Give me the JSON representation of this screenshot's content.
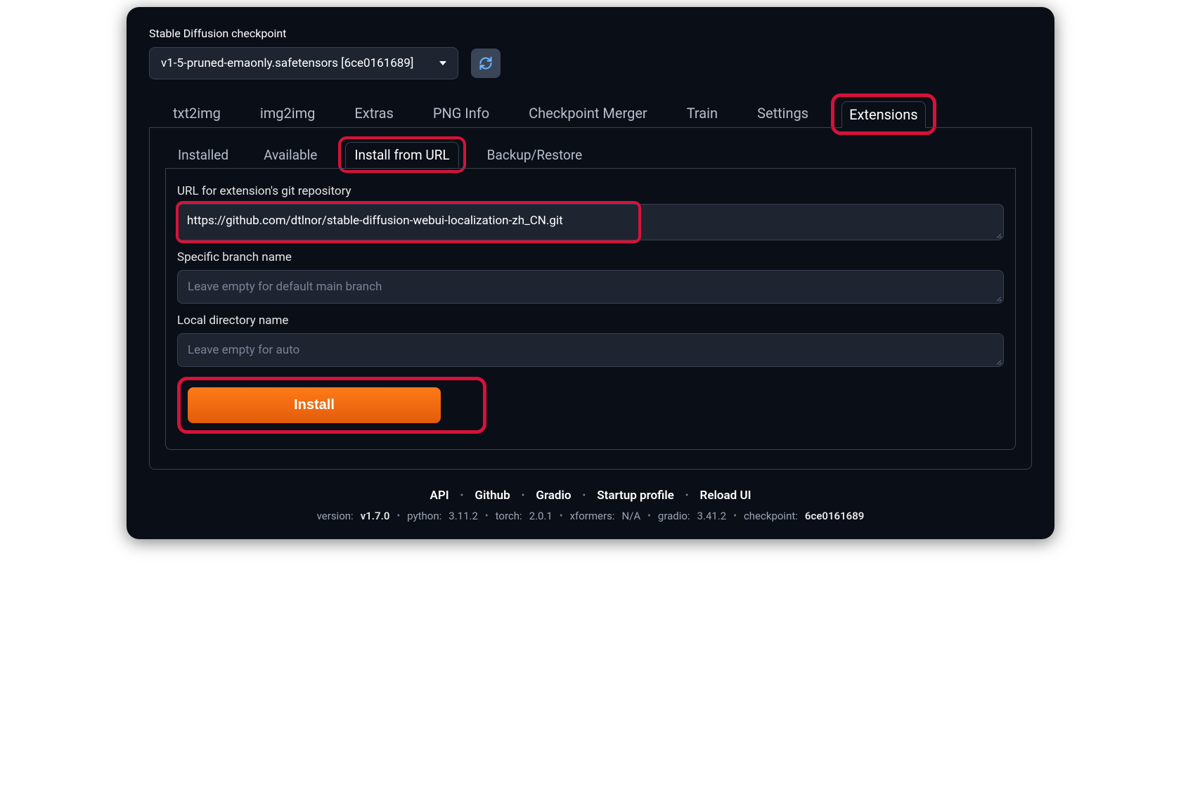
{
  "checkpoint": {
    "label": "Stable Diffusion checkpoint",
    "value": "v1-5-pruned-emaonly.safetensors [6ce0161689]"
  },
  "main_tabs": [
    {
      "label": "txt2img"
    },
    {
      "label": "img2img"
    },
    {
      "label": "Extras"
    },
    {
      "label": "PNG Info"
    },
    {
      "label": "Checkpoint Merger"
    },
    {
      "label": "Train"
    },
    {
      "label": "Settings"
    },
    {
      "label": "Extensions"
    }
  ],
  "active_main_tab": "Extensions",
  "sub_tabs": [
    {
      "label": "Installed"
    },
    {
      "label": "Available"
    },
    {
      "label": "Install from URL"
    },
    {
      "label": "Backup/Restore"
    }
  ],
  "active_sub_tab": "Install from URL",
  "form": {
    "url_label": "URL for extension's git repository",
    "url_value": "https://github.com/dtlnor/stable-diffusion-webui-localization-zh_CN.git",
    "branch_label": "Specific branch name",
    "branch_placeholder": "Leave empty for default main branch",
    "branch_value": "",
    "dirname_label": "Local directory name",
    "dirname_placeholder": "Leave empty for auto",
    "dirname_value": "",
    "install_button": "Install"
  },
  "footer": {
    "links": [
      "API",
      "Github",
      "Gradio",
      "Startup profile",
      "Reload UI"
    ],
    "meta": {
      "version_label": "version:",
      "version_value": "v1.7.0",
      "python_label": "python:",
      "python_value": "3.11.2",
      "torch_label": "torch:",
      "torch_value": "2.0.1",
      "xformers_label": "xformers:",
      "xformers_value": "N/A",
      "gradio_label": "gradio:",
      "gradio_value": "3.41.2",
      "checkpoint_label": "checkpoint:",
      "checkpoint_value": "6ce0161689"
    }
  }
}
